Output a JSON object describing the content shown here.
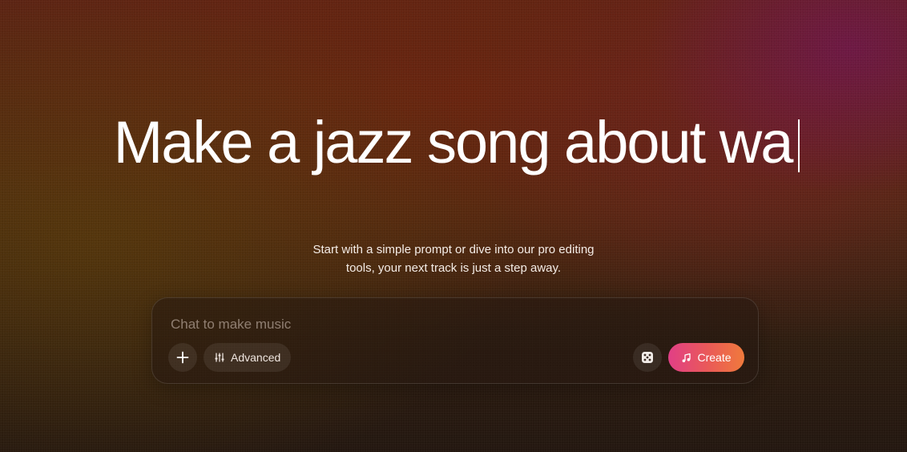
{
  "hero": {
    "headline": "Make a jazz song about wa",
    "subtitle_line1": "Start with a simple prompt or dive into our pro editing",
    "subtitle_line2": "tools, your next track is just a step away."
  },
  "composer": {
    "placeholder": "Chat to make music",
    "value": "",
    "advanced_label": "Advanced",
    "create_label": "Create"
  },
  "icons": {
    "add": "plus-icon",
    "advanced": "sliders-icon",
    "random": "dice-icon",
    "create": "music-note-icon"
  },
  "colors": {
    "create_gradient_start": "#e13f86",
    "create_gradient_end": "#f07a3c"
  }
}
